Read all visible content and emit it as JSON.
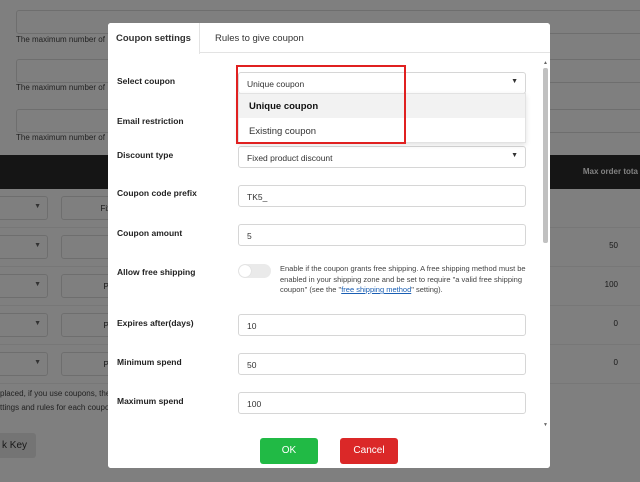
{
  "background": {
    "max_note": "The maximum number of",
    "table_header": "Max order tota",
    "rows": [
      {
        "type": "Fixed",
        "value": ""
      },
      {
        "type": "Fix",
        "value": "50"
      },
      {
        "type": "Perc",
        "value": "100"
      },
      {
        "type": "Perc",
        "value": "0"
      },
      {
        "type": "Perc",
        "value": "0"
      }
    ],
    "footer_line1": "placed, if you use coupons, they w",
    "footer_line2": "ttings and rules for each coupon.",
    "key_button": "k Key"
  },
  "modal": {
    "tabs": [
      "Coupon settings",
      "Rules to give coupon"
    ],
    "fields": {
      "select_coupon": {
        "label": "Select coupon",
        "value": "Unique coupon"
      },
      "email_restriction": {
        "label": "Email restriction"
      },
      "discount_type": {
        "label": "Discount type",
        "value": "Fixed product discount"
      },
      "coupon_code_prefix": {
        "label": "Coupon code prefix",
        "value": "TK5_"
      },
      "coupon_amount": {
        "label": "Coupon amount",
        "value": "5"
      },
      "allow_free_shipping": {
        "label": "Allow free shipping",
        "help_before": "Enable if the coupon grants free shipping. A free shipping method must be enabled in your shipping zone and be set to require \"a valid free shipping coupon\" (see the \"",
        "help_link": "free shipping method",
        "help_after": "\" setting)."
      },
      "expires_after": {
        "label": "Expires after(days)",
        "value": "10"
      },
      "minimum_spend": {
        "label": "Minimum spend",
        "value": "50"
      },
      "maximum_spend": {
        "label": "Maximum spend",
        "value": "100"
      }
    },
    "dropdown_options": [
      "Unique coupon",
      "Existing coupon"
    ],
    "ok_label": "OK",
    "cancel_label": "Cancel"
  },
  "colors": {
    "ok": "#21ba45",
    "cancel": "#db2828",
    "highlight": "#e02020",
    "link": "#1a5fb4"
  }
}
